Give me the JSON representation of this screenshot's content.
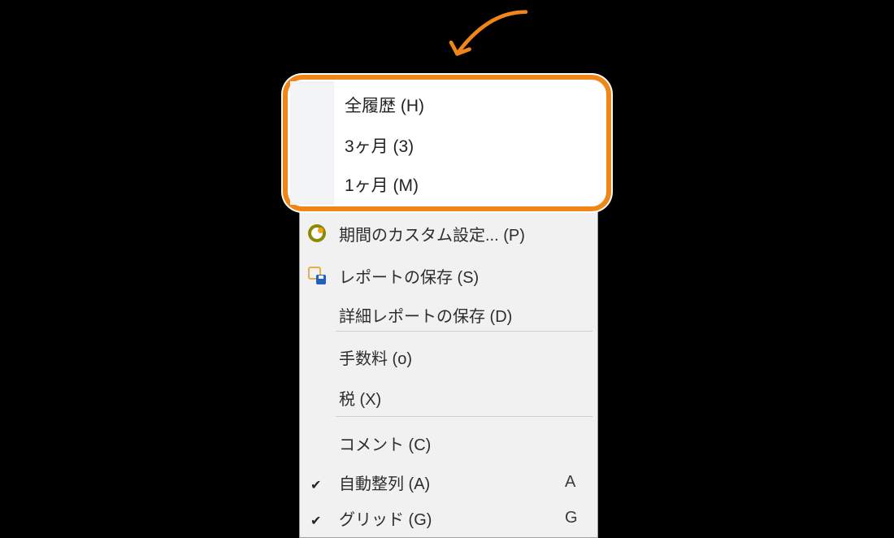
{
  "annotation": {
    "arrow_color": "#f08518",
    "highlight_border_color": "#f08518"
  },
  "highlighted": {
    "items": [
      {
        "label": "全履歴 (H)"
      },
      {
        "label": "3ヶ月 (3)"
      },
      {
        "label": "1ヶ月 (M)"
      }
    ]
  },
  "menu": {
    "items": [
      {
        "id": "all-history",
        "label": "全履歴 (H)",
        "shortcut": "",
        "icon": "",
        "checked": false
      },
      {
        "id": "3-months",
        "label": "3ヶ月 (3)",
        "shortcut": "",
        "icon": "",
        "checked": false
      },
      {
        "id": "1-month",
        "label": "1ヶ月 (M)",
        "shortcut": "",
        "icon": "",
        "checked": false
      },
      {
        "id": "custom-period",
        "label": "期間のカスタム設定... (P)",
        "shortcut": "",
        "icon": "clock-gear",
        "checked": false,
        "sep_after": true
      },
      {
        "id": "save-report",
        "label": "レポートの保存 (S)",
        "shortcut": "",
        "icon": "save",
        "checked": false
      },
      {
        "id": "save-detail",
        "label": "詳細レポートの保存 (D)",
        "shortcut": "",
        "icon": "",
        "checked": false,
        "sep_after": true
      },
      {
        "id": "fees",
        "label": "手数料 (o)",
        "shortcut": "",
        "icon": "",
        "checked": false
      },
      {
        "id": "tax",
        "label": "税 (X)",
        "shortcut": "",
        "icon": "",
        "checked": false
      },
      {
        "id": "comment",
        "label": "コメント (C)",
        "shortcut": "",
        "icon": "",
        "checked": false
      },
      {
        "id": "auto-arrange",
        "label": "自動整列 (A)",
        "shortcut": "A",
        "icon": "",
        "checked": true
      },
      {
        "id": "grid",
        "label": "グリッド (G)",
        "shortcut": "G",
        "icon": "",
        "checked": true
      }
    ]
  }
}
